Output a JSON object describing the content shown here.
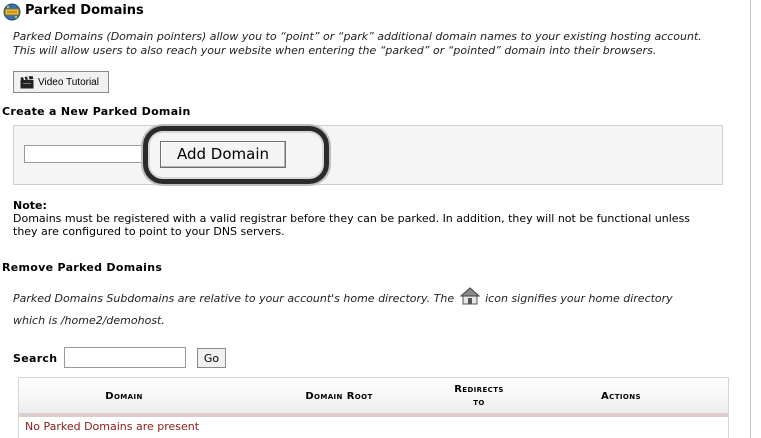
{
  "header": {
    "title": "Parked Domains",
    "intro_line1": "Parked Domains (Domain pointers) allow you to “point” or “park” additional domain names to your existing hosting account.",
    "intro_line2": "This will allow users to also reach your website when entering the “parked” or “pointed” domain into their browsers."
  },
  "video_tutorial": {
    "label": "Video Tutorial"
  },
  "create": {
    "title": "Create a New Parked Domain",
    "input_value": "",
    "add_button": "Add Domain"
  },
  "note": {
    "label": "Note:",
    "line1": "Domains must be registered with a valid registrar before they can be parked. In addition, they will not be functional unless",
    "line2": "they are configured to point to your DNS servers."
  },
  "remove": {
    "title": "Remove Parked Domains",
    "desc_part1": "Parked Domains Subdomains are relative to your account's home directory. The",
    "desc_part2": "icon signifies your home directory",
    "desc_line2": "which is /home2/demohost."
  },
  "search": {
    "label": "Search",
    "value": "",
    "go_button": "Go"
  },
  "table": {
    "headers": {
      "domain": "Domain",
      "domain_root": "Domain Root",
      "redirects_line1": "Redirects",
      "redirects_line2": "to",
      "actions": "Actions"
    },
    "empty_message": "No Parked Domains are present",
    "rows": []
  },
  "icons": {
    "logo": "parked-domains-icon",
    "video": "clapperboard-icon",
    "home": "home-icon"
  },
  "colors": {
    "empty_message": "#8b1a1a",
    "header_accent": "#ddcccc"
  }
}
